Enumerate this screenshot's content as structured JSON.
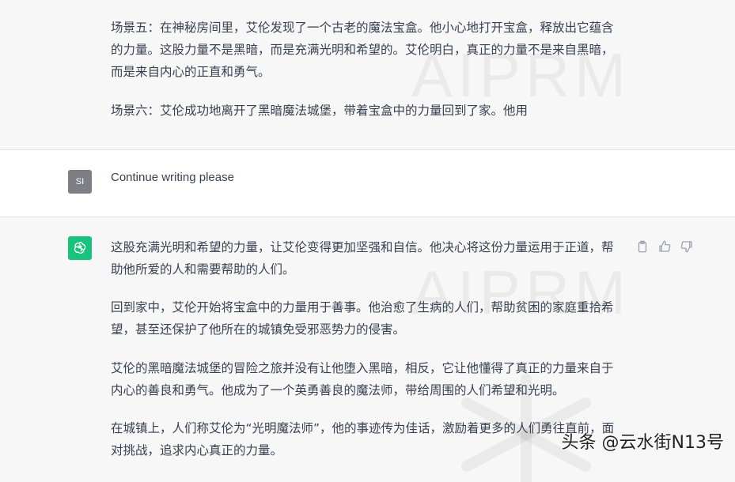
{
  "conversation": {
    "prev_assistant": {
      "paragraphs": [
        "场景五：在神秘房间里，艾伦发现了一个古老的魔法宝盒。他小心地打开宝盒，释放出它蕴含的力量。这股力量不是黑暗，而是充满光明和希望的。艾伦明白，真正的力量不是来自黑暗，而是来自内心的正直和勇气。",
        "场景六：艾伦成功地离开了黑暗魔法城堡，带着宝盒中的力量回到了家。他用"
      ]
    },
    "user": {
      "avatar_text": "SI",
      "message": "Continue writing please"
    },
    "assistant": {
      "paragraphs": [
        "这股充满光明和希望的力量，让艾伦变得更加坚强和自信。他决心将这份力量运用于正道，帮助他所爱的人和需要帮助的人们。",
        "回到家中，艾伦开始将宝盒中的力量用于善事。他治愈了生病的人们，帮助贫困的家庭重拾希望，甚至还保护了他所在的城镇免受邪恶势力的侵害。",
        "艾伦的黑暗魔法城堡的冒险之旅并没有让他堕入黑暗，相反，它让他懂得了真正的力量来自于内心的善良和勇气。他成为了一个英勇善良的魔法师，带给周围的人们希望和光明。",
        "在城镇上，人们称艾伦为“光明魔法师”，他的事迹传为佳话，激励着更多的人们勇往直前，面对挑战，追求内心真正的力量。"
      ],
      "actions": [
        "clipboard-icon",
        "thumbs-up-icon",
        "thumbs-down-icon"
      ]
    }
  },
  "watermark": {
    "brand": "AIPRM",
    "source": "头条 @云水街N13号"
  },
  "colors": {
    "assistant_bg": "#f7f7f8",
    "user_bg": "#ffffff",
    "bot_avatar": "#19c37d",
    "user_avatar": "#7d7f84",
    "text": "#374151"
  }
}
